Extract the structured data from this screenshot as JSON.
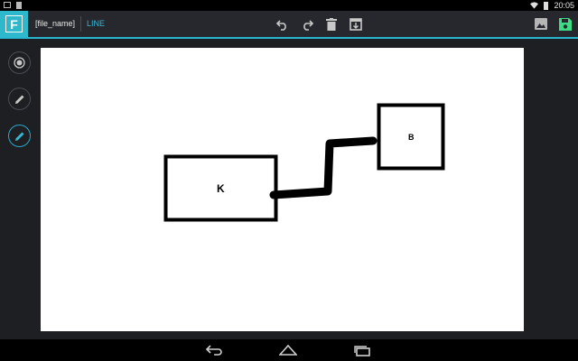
{
  "status_bar": {
    "time": "20:05",
    "icons": [
      "image-notification-icon",
      "file-notification-icon",
      "wifi-icon",
      "battery-icon"
    ]
  },
  "action_bar": {
    "file_name": "[file_name]",
    "mode": "LINE",
    "toolbar": [
      "undo-icon",
      "redo-icon",
      "delete-icon",
      "fit-screen-icon"
    ],
    "right_actions": [
      "export-image-icon",
      "save-icon"
    ]
  },
  "tools": [
    {
      "name": "shape-tool",
      "icon": "record-icon",
      "active": false
    },
    {
      "name": "pen-tool",
      "icon": "pencil-icon",
      "active": false
    },
    {
      "name": "line-tool",
      "icon": "pencil-icon",
      "active": true
    }
  ],
  "canvas": {
    "shapes": [
      {
        "type": "box",
        "label": "K"
      },
      {
        "type": "box",
        "label": "B"
      }
    ],
    "connector": {
      "type": "freehand-line"
    }
  },
  "nav_bar": [
    "back-icon",
    "home-icon",
    "recent-apps-icon"
  ],
  "colors": {
    "accent": "#2eb8cc",
    "active_text": "#36b7d6",
    "toolbar_bg": "#26282d",
    "app_bg": "#1e1f23",
    "canvas_bg": "#ffffff",
    "save_icon": "#3ddc84"
  }
}
